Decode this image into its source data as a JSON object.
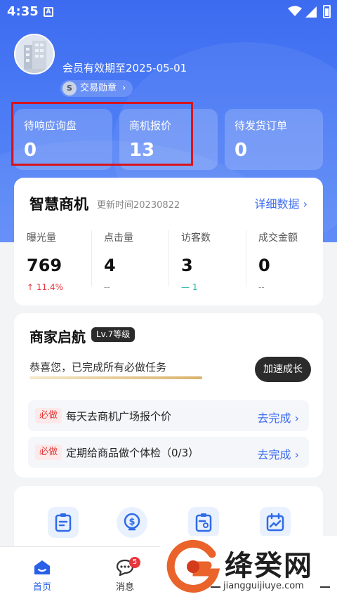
{
  "status_bar": {
    "time": "4:35",
    "notification_glyph": "A"
  },
  "profile": {
    "membership_text": "会员有效期至2025-05-01",
    "badge_coin": "S",
    "badge_label": "交易勋章",
    "badge_chevron": "›"
  },
  "stats": [
    {
      "label": "待响应询盘",
      "value": "0"
    },
    {
      "label": "商机报价",
      "value": "13"
    },
    {
      "label": "待发货订单",
      "value": "0"
    }
  ],
  "smart_opportunity": {
    "title": "智慧商机",
    "update_time": "更新时间20230822",
    "detail_link": "详细数据",
    "metrics": [
      {
        "label": "曝光量",
        "value": "769",
        "change": "↑ 11.4%",
        "trend": "up"
      },
      {
        "label": "点击量",
        "value": "4",
        "change": "--",
        "trend": "none"
      },
      {
        "label": "访客数",
        "value": "3",
        "change": "— 1",
        "trend": "flat"
      },
      {
        "label": "成交金额",
        "value": "0",
        "change": "--",
        "trend": "none"
      }
    ]
  },
  "merchant_launch": {
    "title": "商家启航",
    "level_badge": "Lv.7等级",
    "message": "恭喜您，已完成所有必做任务",
    "progress_fraction": 1.0,
    "grow_button": "加速成长",
    "tasks": [
      {
        "tag": "必做",
        "text": "每天去商机广场报个价",
        "action": "去完成"
      },
      {
        "tag": "必做",
        "text": "定期给商品做个体检（0/3）",
        "action": "去完成"
      }
    ]
  },
  "tools": [
    {
      "icon": "clipboard-edit-icon"
    },
    {
      "icon": "money-bulb-icon"
    },
    {
      "icon": "clipboard-settings-icon"
    },
    {
      "icon": "calendar-chart-icon"
    }
  ],
  "tab_bar": {
    "tabs": [
      {
        "label": "首页",
        "icon": "home-icon",
        "active": true
      },
      {
        "label": "消息",
        "icon": "chat-icon",
        "badge": "5"
      }
    ]
  },
  "watermark": {
    "text": "绛癸网",
    "url": "jiangguijiuye.com"
  },
  "colors": {
    "brand_blue": "#3d6bf0",
    "link_blue": "#3c6cf0",
    "alert_red": "#e8363d",
    "highlight_box": "#d7141e"
  }
}
